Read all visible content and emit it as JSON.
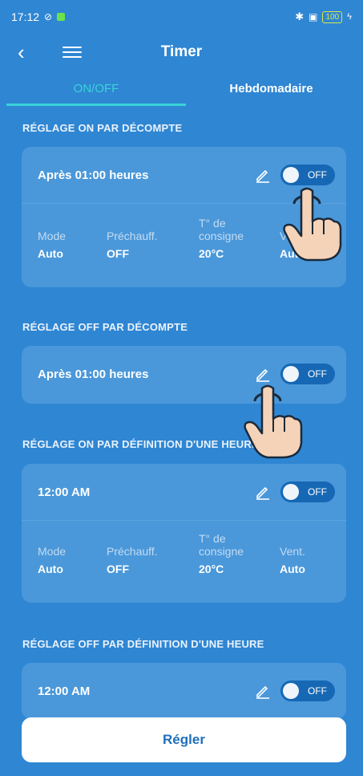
{
  "status": {
    "time": "17:12",
    "battery": "100"
  },
  "header": {
    "title": "Timer"
  },
  "tabs": [
    {
      "label": "ON/OFF"
    },
    {
      "label": "Hebdomadaire"
    }
  ],
  "sections": [
    {
      "title": "RÉGLAGE ON PAR DÉCOMPTE",
      "row_label": "Après 01:00 heures",
      "toggle": "OFF",
      "details": [
        {
          "key": "Mode",
          "value": "Auto"
        },
        {
          "key": "Préchauff.",
          "value": "OFF"
        },
        {
          "key": "T° de consigne",
          "value": "20°C"
        },
        {
          "key": "Vent.",
          "value": "Auto"
        }
      ]
    },
    {
      "title": "RÉGLAGE OFF PAR DÉCOMPTE",
      "row_label": "Après 01:00 heures",
      "toggle": "OFF"
    },
    {
      "title": "RÉGLAGE ON PAR DÉFINITION D'UNE HEURE",
      "row_label": "12:00 AM",
      "toggle": "OFF",
      "details": [
        {
          "key": "Mode",
          "value": "Auto"
        },
        {
          "key": "Préchauff.",
          "value": "OFF"
        },
        {
          "key": "T° de consigne",
          "value": "20°C"
        },
        {
          "key": "Vent.",
          "value": "Auto"
        }
      ]
    },
    {
      "title": "RÉGLAGE OFF PAR DÉFINITION D'UNE HEURE",
      "row_label": "12:00 AM",
      "toggle": "OFF"
    }
  ],
  "footer": {
    "button_label": "Régler"
  },
  "colors": {
    "background": "#2f86d3",
    "card": "#4a98da",
    "accent": "#38d3d8",
    "toggle": "#1668b5"
  }
}
